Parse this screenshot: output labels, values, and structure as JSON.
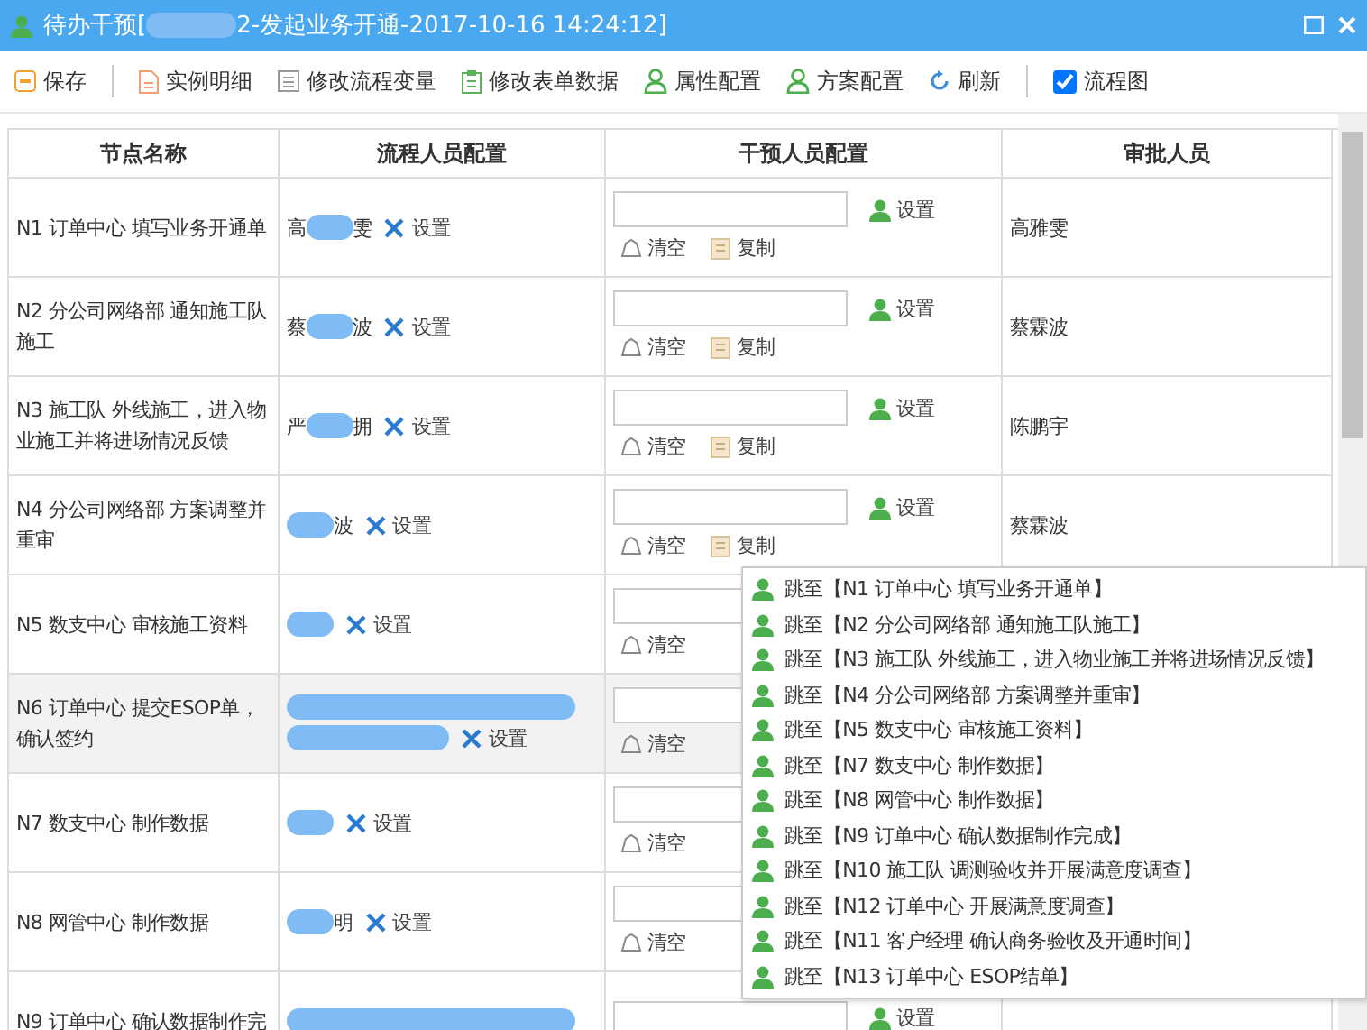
{
  "window": {
    "title_before": "待办干预[",
    "title_after": "2-发起业务开通-2017-10-16 14:24:12]"
  },
  "toolbar": [
    {
      "kind": "save",
      "label": "保存"
    },
    {
      "kind": "divider"
    },
    {
      "kind": "doc",
      "label": "实例明细"
    },
    {
      "kind": "form",
      "label": "修改流程变量"
    },
    {
      "kind": "clip",
      "label": "修改表单数据"
    },
    {
      "kind": "user",
      "label": "属性配置"
    },
    {
      "kind": "user",
      "label": "方案配置"
    },
    {
      "kind": "refresh",
      "label": "刷新"
    },
    {
      "kind": "divider"
    },
    {
      "kind": "check",
      "label": "流程图",
      "checked": true
    }
  ],
  "table": {
    "columns": [
      "节点名称",
      "流程人员配置",
      "干预人员配置",
      "审批人员"
    ],
    "rows": [
      {
        "node": "N1 订单中心 填写业务开通单",
        "staff_before": "高",
        "staff_after": "雯",
        "set": "设置",
        "intervene_set": "设置",
        "clear": "清空",
        "copy": "复制",
        "approver": "高雅雯",
        "selected": false
      },
      {
        "node": "N2 分公司网络部 通知施工队施工",
        "staff_before": "蔡",
        "staff_after": "波",
        "set": "设置",
        "intervene_set": "设置",
        "clear": "清空",
        "copy": "复制",
        "approver": "蔡霖波",
        "selected": false
      },
      {
        "node": "N3 施工队 外线施工，进入物业施工并将进场情况反馈",
        "staff_before": "严",
        "staff_after": "拥",
        "set": "设置",
        "intervene_set": "设置",
        "clear": "清空",
        "copy": "复制",
        "approver": "陈鹏宇",
        "selected": false
      },
      {
        "node": "N4 分公司网络部 方案调整并重审",
        "staff_before": "",
        "staff_after": "波",
        "set": "设置",
        "intervene_set": "设置",
        "clear": "清空",
        "copy": "复制",
        "approver": "蔡霖波",
        "selected": false
      },
      {
        "node": "N5 数支中心 审核施工资料",
        "staff_before": "",
        "staff_after": "",
        "set": "设置",
        "clear": "清空",
        "selected": false
      },
      {
        "node": "N6 订单中心 提交ESOP单，确认签约",
        "staff_before": "",
        "staff_after": "",
        "staff_long": true,
        "set": "设置",
        "clear": "清空",
        "selected": true
      },
      {
        "node": "N7 数支中心 制作数据",
        "staff_before": "",
        "staff_after": "",
        "set": "设置",
        "clear": "清空",
        "selected": false
      },
      {
        "node": "N8 网管中心 制作数据",
        "staff_before": "",
        "staff_after": "明",
        "set": "设置",
        "clear": "清空",
        "selected": false
      },
      {
        "node": "N9 订单中心 确认数据制作完",
        "staff_before": "",
        "staff_after": "",
        "staff_long": true,
        "intervene_set": "设置",
        "selected": false
      }
    ]
  },
  "jump_menu": [
    "跳至【N1 订单中心 填写业务开通单】",
    "跳至【N2 分公司网络部 通知施工队施工】",
    "跳至【N3 施工队 外线施工，进入物业施工并将进场情况反馈】",
    "跳至【N4 分公司网络部 方案调整并重审】",
    "跳至【N5 数支中心 审核施工资料】",
    "跳至【N7 数支中心 制作数据】",
    "跳至【N8 网管中心 制作数据】",
    "跳至【N9 订单中心 确认数据制作完成】",
    "跳至【N10 施工队 调测验收并开展满意度调查】",
    "跳至【N12 订单中心 开展满意度调查】",
    "跳至【N11 客户经理 确认商务验收及开通时间】",
    "跳至【N13 订单中心 ESOP结单】"
  ]
}
